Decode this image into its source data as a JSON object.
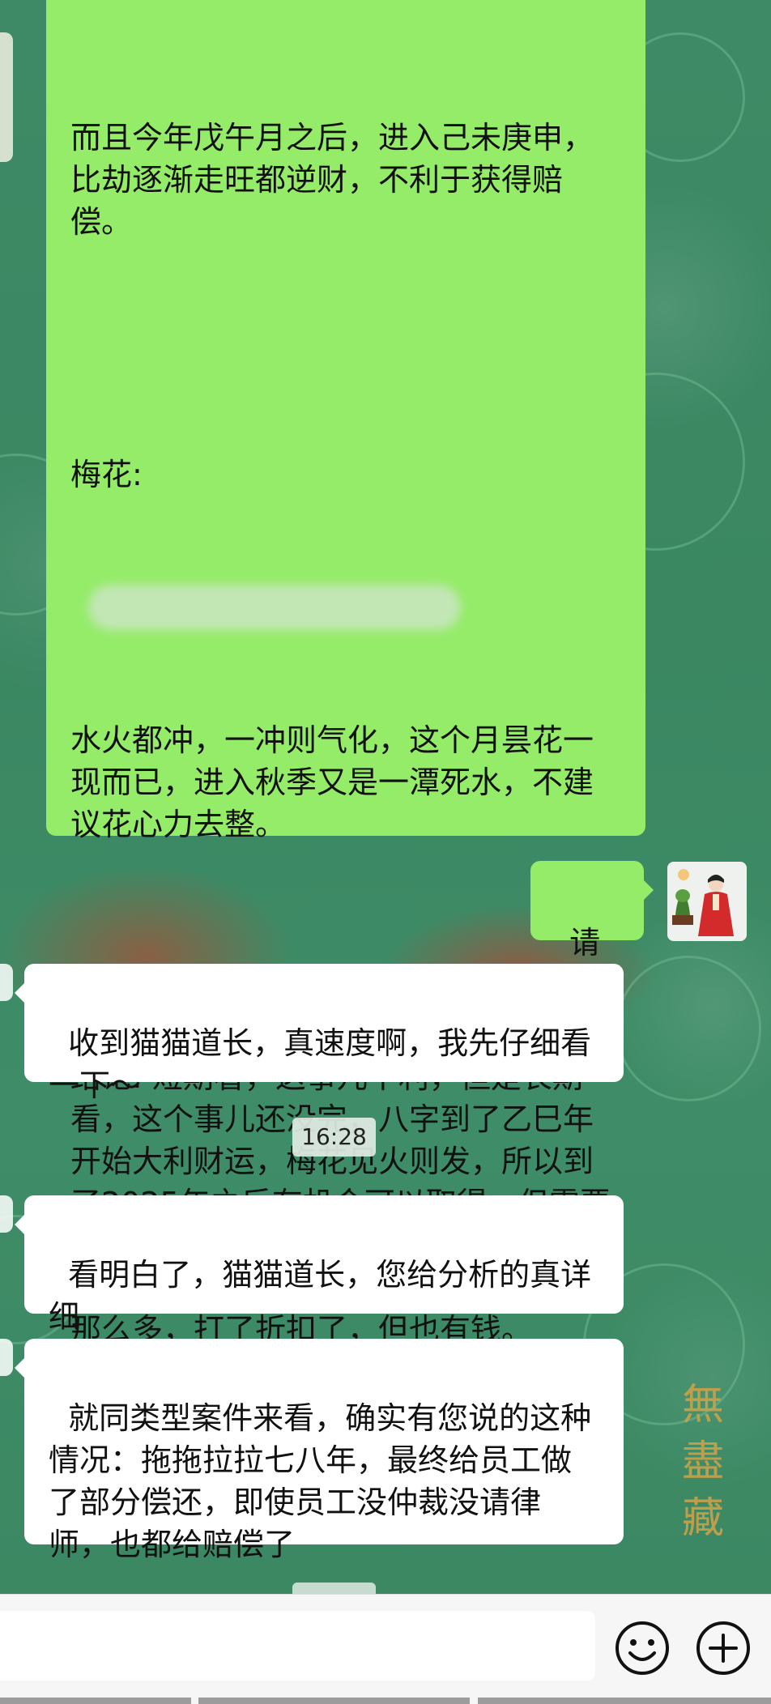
{
  "chat": {
    "top_message": {
      "para1": "而且今年戊午月之后，进入己未庚申，比劫逐渐走旺都逆财，不利于获得赔偿。",
      "plum_label": "梅花:",
      "para2": "水火都冲，一冲则气化，这个月昙花一现而已，进入秋季又是一潭死水，不建议花心力去整。",
      "conclusion": "结论: 短期看，这事儿不利，但是长期看，这个事儿还没完，八字到了乙巳年开始大利财运，梅花见火则发，所以到了2025年之后有机会可以取得，但需要注意的是，八字结构占比劫，梅花对冲，取得的一定是按比例，没有20多万那么多，打了折扣了，但也有钱。"
    },
    "my_reply": "请收",
    "messages": [
      {
        "text": "收到猫猫道长，真速度啊，我先仔细看一下～"
      },
      {
        "text": "看明白了，猫猫道长，您给分析的真详细"
      },
      {
        "text": "就同类型案件来看，确实有您说的这种情况：拖拖拉拉七八年，最终给员工做了部分偿还，即使员工没仲裁没请律师，也都给赔偿了"
      }
    ],
    "timestamp": "16:28",
    "background_seal": "無盡藏"
  },
  "input_bar": {
    "emoji_icon": "emoji-smile-icon",
    "plus_icon": "plus-circle-icon"
  },
  "colors": {
    "my_bubble": "#95ec69",
    "their_bubble": "#ffffff",
    "chat_background": "#3f8c66"
  }
}
